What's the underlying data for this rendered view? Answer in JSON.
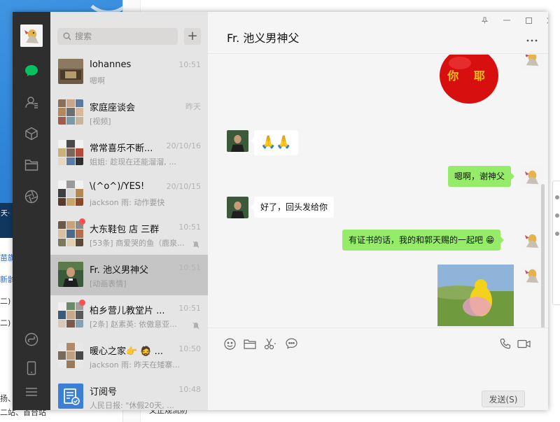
{
  "search": {
    "placeholder": "搜索"
  },
  "chats": [
    {
      "name": "Iohannes",
      "time": "10:51",
      "preview": "嗯啊"
    },
    {
      "name": "家庭座谈会",
      "time": "昨天",
      "preview": "[视频]"
    },
    {
      "name": "常常喜乐不断...",
      "time": "20/10/16",
      "preview": "姐姐: 趁现在还能溜溜, ..."
    },
    {
      "name": "\\(^o^)/YES!",
      "time": "20/10/15",
      "preview": "jackson 雨: 动作要快"
    },
    {
      "name": "大东鞋包 店 三群",
      "time": "10:51",
      "preview": "[53条] 商爱哭的鱼（鹿泉..."
    },
    {
      "name": "Fr. 池义男神父",
      "time": "10:51",
      "preview": "[动画表情]"
    },
    {
      "name": "柏乡营儿教堂片 ...",
      "time": "10:51",
      "preview": "[2条] 赵素英: 依傲意亚..."
    },
    {
      "name": "暖心之家👉 🧔 ...",
      "time": "10:50",
      "preview": "jackson 雨: 昨天在矮寨..."
    },
    {
      "name": "订阅号",
      "time": "10:48",
      "preview": "人民日报: \"休假20天, ..."
    }
  ],
  "conversation": {
    "title": "Fr. 池义男神父",
    "messages": {
      "sticker_text": "你 耶",
      "prayer": "🙏🙏",
      "reply1": "嗯啊，谢神父",
      "incoming2": "好了，回头发给你",
      "reply2": "有证书的话，我的和郭天赐的一起吧 😁"
    }
  },
  "input": {
    "send_label": "发送(S)"
  },
  "background": {
    "left_bar": "天·",
    "left_lines": [
      "苗旗",
      "新龄",
      "二)",
      "二)"
    ],
    "left_bottom": [
      "扬、(",
      "二站、首台站"
    ],
    "mid_bottom": "又正规流防"
  },
  "colors": {
    "rail": "#2e2e2e",
    "list": "#e6e5e5",
    "selected": "#c6c5c5",
    "out_bubble": "#95ec69",
    "brand_green": "#07c160",
    "unread": "#fa5151"
  }
}
